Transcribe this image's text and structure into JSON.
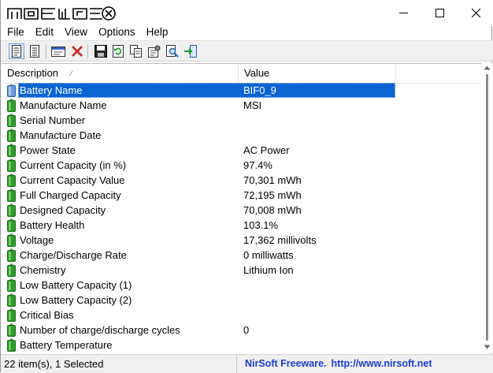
{
  "menu": [
    "File",
    "Edit",
    "View",
    "Options",
    "Help"
  ],
  "columns": {
    "description": "Description",
    "value": "Value"
  },
  "rows": [
    {
      "description": "Battery Name",
      "value": "BIF0_9",
      "selected": true
    },
    {
      "description": "Manufacture Name",
      "value": "MSI"
    },
    {
      "description": "Serial Number",
      "value": ""
    },
    {
      "description": "Manufacture Date",
      "value": ""
    },
    {
      "description": "Power State",
      "value": "AC Power"
    },
    {
      "description": "Current Capacity (in %)",
      "value": "97.4%"
    },
    {
      "description": "Current Capacity Value",
      "value": "70,301 mWh"
    },
    {
      "description": "Full Charged Capacity",
      "value": "72,195 mWh"
    },
    {
      "description": "Designed Capacity",
      "value": "70,008 mWh"
    },
    {
      "description": "Battery Health",
      "value": "103.1%"
    },
    {
      "description": "Voltage",
      "value": "17,362 millivolts"
    },
    {
      "description": "Charge/Discharge Rate",
      "value": "0 milliwatts"
    },
    {
      "description": "Chemistry",
      "value": "Lithium Ion"
    },
    {
      "description": "Low Battery Capacity (1)",
      "value": ""
    },
    {
      "description": "Low Battery Capacity (2)",
      "value": ""
    },
    {
      "description": "Critical Bias",
      "value": ""
    },
    {
      "description": "Number of charge/discharge cycles",
      "value": "0"
    },
    {
      "description": "Battery Temperature",
      "value": ""
    }
  ],
  "status": {
    "items": "22 item(s), 1 Selected",
    "credit_name": "NirSoft Freeware.",
    "credit_url": "http://www.nirsoft.net"
  },
  "toolbar_icons": [
    "html-report-icon",
    "text-report-icon",
    "properties-icon",
    "delete-icon",
    "save-icon",
    "refresh-icon",
    "copy-icon",
    "options-icon",
    "find-icon",
    "exit-icon"
  ],
  "colors": {
    "selection": "#0a64d2",
    "battery_icon": "#2e9d2a",
    "credit_text": "#1a3cd8"
  }
}
